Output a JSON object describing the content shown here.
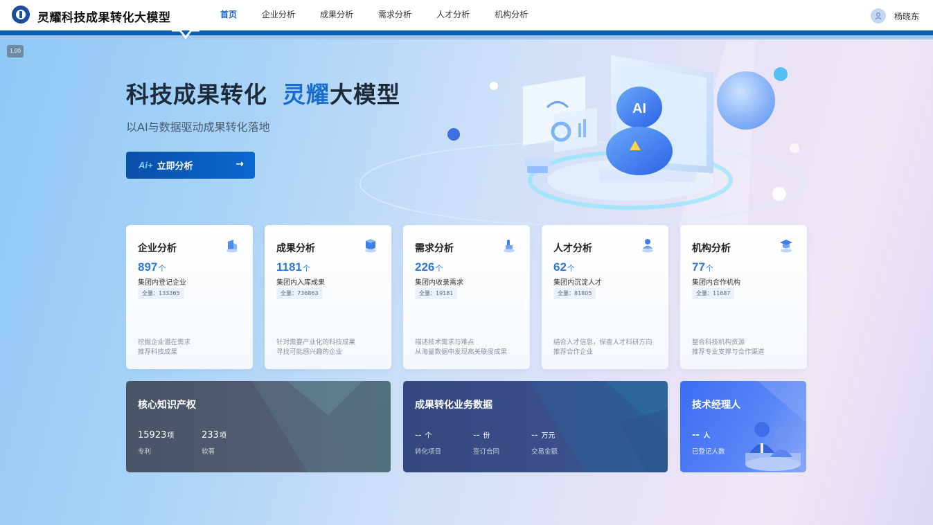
{
  "header": {
    "app_title": "灵耀科技成果转化大模型",
    "nav": [
      "首页",
      "企业分析",
      "成果分析",
      "需求分析",
      "人才分析",
      "机构分析"
    ],
    "active_nav": "首页",
    "user_name": "杨晓东"
  },
  "zoom": "1.00",
  "hero": {
    "title_a": "科技成果转化",
    "title_accent": "灵耀",
    "title_b": "大模型",
    "subtitle": "以AI与数据驱动成果转化落地",
    "cta_ai": "Ai+",
    "cta_label": "立即分析",
    "cta_arrow": "→",
    "art_ai_text": "AI"
  },
  "cards": [
    {
      "title": "企业分析",
      "count": "897",
      "unit": "个",
      "label": "集团内登记企业",
      "total": "全量：133365",
      "desc1": "挖掘企业潜在需求",
      "desc2": "推荐科技成果",
      "icon": "building-icon"
    },
    {
      "title": "成果分析",
      "count": "1181",
      "unit": "个",
      "label": "集团内入库成果",
      "total": "全量：736863",
      "desc1": "针对需要产业化的科技成果",
      "desc2": "寻找可能感兴趣的企业",
      "icon": "cube-icon"
    },
    {
      "title": "需求分析",
      "count": "226",
      "unit": "个",
      "label": "集团内收录需求",
      "total": "全量：19181",
      "desc1": "描述技术需求与难点",
      "desc2": "从海量数据中发现高关联度成果",
      "icon": "hand-icon"
    },
    {
      "title": "人才分析",
      "count": "62",
      "unit": "个",
      "label": "集团内沉淀人才",
      "total": "全量：81805",
      "desc1": "结合人才信息，探查人才科研方向",
      "desc2": "推荐合作企业",
      "icon": "person-icon"
    },
    {
      "title": "机构分析",
      "count": "77",
      "unit": "个",
      "label": "集团内合作机构",
      "total": "全量：11687",
      "desc1": "整合科技机构资源",
      "desc2": "推荐专业支撑与合作渠道",
      "icon": "graduation-cap-icon"
    }
  ],
  "panels": {
    "ip": {
      "title": "核心知识产权",
      "stats": [
        {
          "value": "15923",
          "unit": "项",
          "label": "专利"
        },
        {
          "value": "233",
          "unit": "项",
          "label": "软著"
        }
      ]
    },
    "business": {
      "title": "成果转化业务数据",
      "stats": [
        {
          "value": "--",
          "unit": "个",
          "label": "转化项目"
        },
        {
          "value": "--",
          "unit": "份",
          "label": "签订合同"
        },
        {
          "value": "--",
          "unit": "万元",
          "label": "交易金额"
        }
      ]
    },
    "manager": {
      "title": "技术经理人",
      "stats": [
        {
          "value": "--",
          "unit": "人",
          "label": "已登记人数"
        }
      ]
    }
  },
  "colors": {
    "brand": "#0b5eab",
    "accent": "#1a6dd0",
    "number": "#2f78d6"
  }
}
